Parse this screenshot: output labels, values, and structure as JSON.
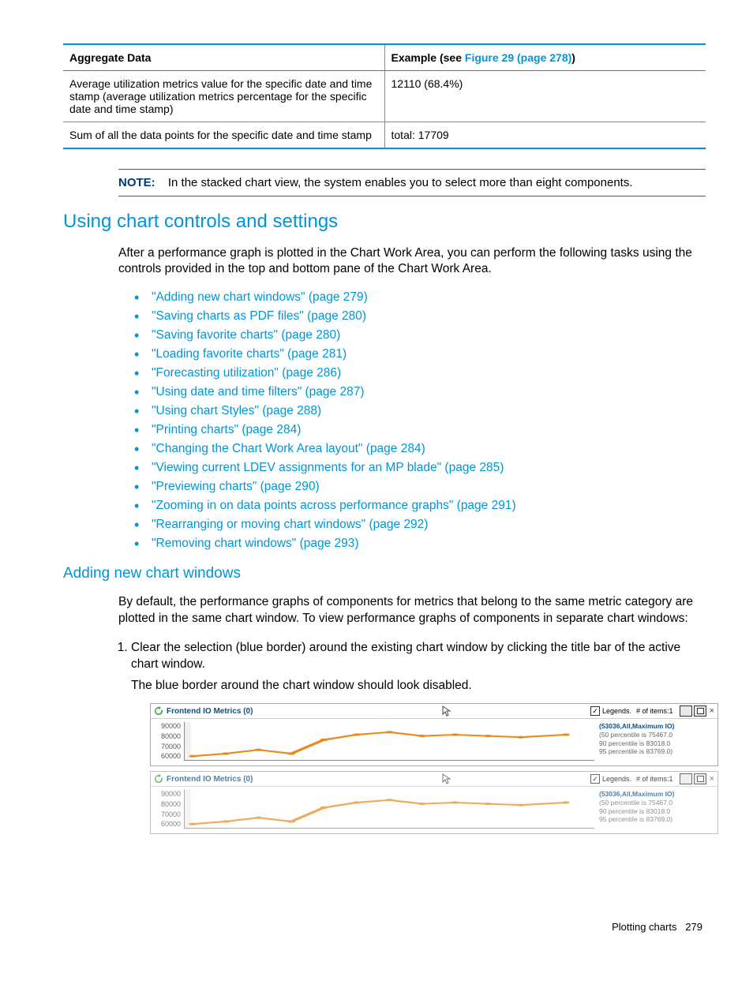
{
  "table": {
    "headers": {
      "c1": "Aggregate Data",
      "c2_prefix": "Example (see ",
      "c2_link": "Figure 29 (page 278)",
      "c2_suffix": ")"
    },
    "rows": [
      {
        "c1": "Average utilization metrics value for the specific date and time stamp (average utilization metrics percentage for the specific date and time stamp)",
        "c2": "12110 (68.4%)"
      },
      {
        "c1": "Sum of all the data points for the specific date and time stamp",
        "c2": "total: 17709"
      }
    ]
  },
  "note": {
    "label": "NOTE:",
    "text": "In the stacked chart view, the system enables you to select more than eight components."
  },
  "section": {
    "title": "Using chart controls and settings",
    "intro": "After a performance graph is plotted in the Chart Work Area, you can perform the following tasks using the controls provided in the top and bottom pane of the Chart Work Area."
  },
  "bullets": [
    "\"Adding new chart windows\" (page 279)",
    "\"Saving charts as PDF files\" (page 280)",
    "\"Saving favorite charts\" (page 280)",
    "\"Loading favorite charts\" (page 281)",
    "\"Forecasting utilization\" (page 286)",
    "\"Using date and time filters\" (page 287)",
    "\"Using chart Styles\" (page 288)",
    "\"Printing charts\" (page 284)",
    "\"Changing the Chart Work Area layout\" (page 284)",
    "\"Viewing current LDEV assignments for an MP blade\" (page 285)",
    "\"Previewing charts\" (page 290)",
    "\"Zooming in on data points across performance graphs\" (page 291)",
    "\"Rearranging or moving chart windows\" (page 292)",
    "\"Removing chart windows\" (page 293)"
  ],
  "subsection": {
    "title": "Adding new chart windows",
    "intro": "By default, the performance graphs of components for metrics that belong to the same metric category are plotted in the same chart window. To view performance graphs of components in separate chart windows:",
    "step1": "Clear the selection (blue border) around the existing chart window by clicking the title bar of the active chart window.",
    "step1_sub": "The blue border around the chart window should look disabled."
  },
  "chart_ui": {
    "title": "Frontend IO Metrics (0)",
    "legends_label": "Legends.",
    "items_label": "# of items:1",
    "y_ticks": [
      "90000",
      "80000",
      "70000",
      "60000"
    ],
    "annot_main": "(53036,All,Maximum IO)",
    "annot_lines": [
      "(50 percentile is 75467.0",
      "90 percentile is 83018.0",
      "95 percentile is 83769.0)"
    ]
  },
  "chart_data": [
    {
      "type": "line",
      "title": "Frontend IO Metrics (0)",
      "ylabel": "",
      "ylim": [
        60000,
        90000
      ],
      "series": [
        {
          "name": "53036,All,Maximum IO",
          "x": [
            0,
            1,
            2,
            3,
            4,
            5,
            6,
            7,
            8,
            9,
            10,
            11
          ],
          "values": [
            62000,
            64000,
            67000,
            64000,
            76000,
            80000,
            82000,
            79000,
            80000,
            79000,
            78000,
            80000
          ]
        }
      ],
      "annotations": {
        "50_percentile": 75467.0,
        "90_percentile": 83018.0,
        "95_percentile": 83769.0
      }
    },
    {
      "type": "line",
      "title": "Frontend IO Metrics (0)",
      "ylabel": "",
      "ylim": [
        60000,
        90000
      ],
      "series": [
        {
          "name": "53036,All,Maximum IO",
          "x": [
            0,
            1,
            2,
            3,
            4,
            5,
            6,
            7,
            8,
            9,
            10,
            11
          ],
          "values": [
            62000,
            64000,
            67000,
            64000,
            76000,
            80000,
            82000,
            79000,
            80000,
            79000,
            78000,
            80000
          ]
        }
      ],
      "annotations": {
        "50_percentile": 75467.0,
        "90_percentile": 83018.0,
        "95_percentile": 83769.0
      }
    }
  ],
  "footer": {
    "section": "Plotting charts",
    "page": "279"
  }
}
